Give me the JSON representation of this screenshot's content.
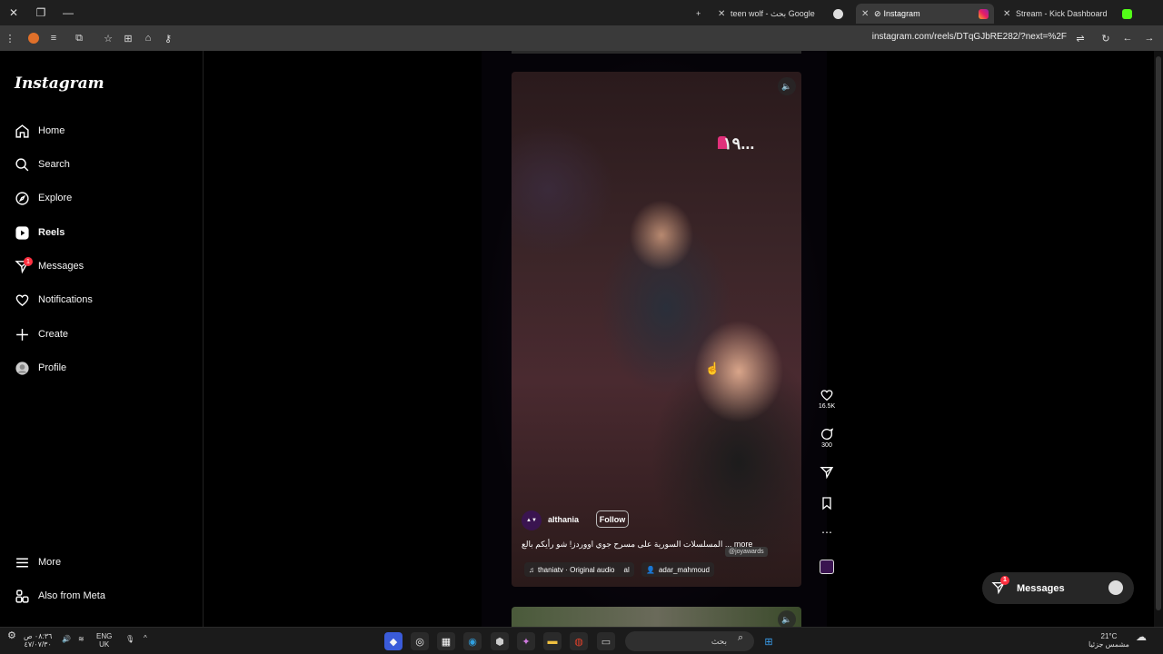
{
  "browser": {
    "tabs": [
      {
        "title": "teen wolf - بحث Google",
        "active": false
      },
      {
        "title": "Instagram",
        "active": true
      },
      {
        "title": "Stream - Kick Dashboard",
        "active": false
      }
    ],
    "url": "instagram.com/reels/DTqGJbRE282/?next=%2F",
    "new_tab": "+"
  },
  "sidebar": {
    "logo": "Instagram",
    "items": [
      {
        "label": "Home",
        "icon": "home-icon"
      },
      {
        "label": "Search",
        "icon": "search-icon"
      },
      {
        "label": "Explore",
        "icon": "compass-icon"
      },
      {
        "label": "Reels",
        "icon": "reels-icon"
      },
      {
        "label": "Messages",
        "icon": "messenger-icon",
        "badge": "1"
      },
      {
        "label": "Notifications",
        "icon": "heart-icon"
      },
      {
        "label": "Create",
        "icon": "plus-icon"
      },
      {
        "label": "Profile",
        "icon": "profile-avatar-icon"
      }
    ],
    "bottom": [
      {
        "label": "More",
        "icon": "menu-icon"
      },
      {
        "label": "Also from Meta",
        "icon": "meta-apps-icon"
      }
    ]
  },
  "reel": {
    "watermark": "١٩...",
    "username": "althania",
    "follow_label": "Follow",
    "caption": "المسلسلات السورية على مسرح جوي اووردز! شو رأيكم بالع ... more",
    "tag": "@joyawards",
    "audio": "thaniatv · Original audio",
    "audio_extra": "al",
    "tagged_user": "adar_mahmoud",
    "likes": "16.5K",
    "comments": "300"
  },
  "messages_pill": {
    "label": "Messages",
    "badge": "1"
  },
  "taskbar": {
    "time": "٠٨:٣٦ ص",
    "date": "٤٧/٠٧/٣٠",
    "lang_top": "ENG",
    "lang_bottom": "UK",
    "search_placeholder": "بحث",
    "weather_temp": "21°C",
    "weather_desc": "مشمس جزئيا"
  },
  "colors": {
    "accent_red": "#ff3040",
    "bg": "#000000",
    "panel": "#262626"
  }
}
